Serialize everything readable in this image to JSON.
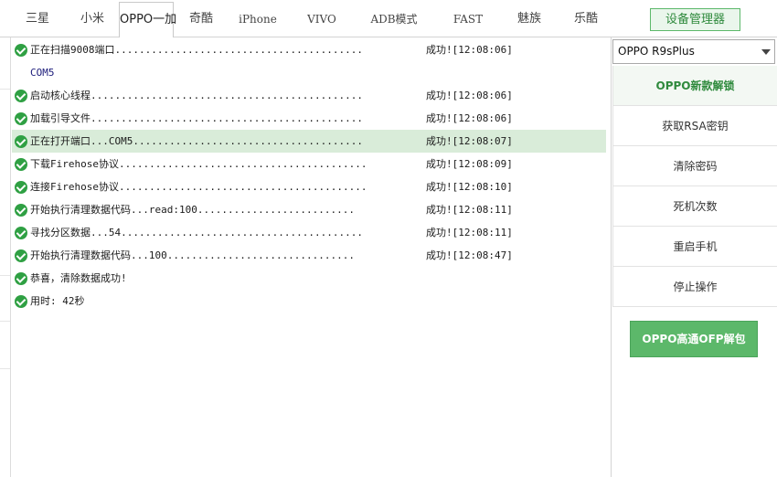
{
  "tabs": [
    {
      "label": "三星"
    },
    {
      "label": "小米"
    },
    {
      "label": "OPPO一加"
    },
    {
      "label": "奇酷"
    },
    {
      "label": "iPhone"
    },
    {
      "label": "VIVO"
    },
    {
      "label": "ADB模式"
    },
    {
      "label": "FAST"
    },
    {
      "label": "魅族"
    },
    {
      "label": "乐酷"
    }
  ],
  "active_tab": "OPPO一加",
  "device_manager_label": "设备管理器",
  "log": [
    {
      "text": "正在扫描9008端口.........................................",
      "result": "成功![12:08:06]",
      "icon": "check-circle-icon"
    },
    {
      "text": "COM5",
      "result": "",
      "icon": ""
    },
    {
      "text": "启动核心线程.............................................",
      "result": "成功![12:08:06]",
      "icon": "check-circle-icon"
    },
    {
      "text": "加载引导文件.............................................",
      "result": "成功![12:08:06]",
      "icon": "check-circle-icon"
    },
    {
      "text": "正在打开端口...COM5......................................",
      "result": "成功![12:08:07]",
      "icon": "check-circle-icon",
      "highlighted": true
    },
    {
      "text": "下载Firehose协议.........................................",
      "result": "成功![12:08:09]",
      "icon": "check-circle-icon"
    },
    {
      "text": "连接Firehose协议.........................................",
      "result": "成功![12:08:10]",
      "icon": "check-circle-icon"
    },
    {
      "text": "开始执行清理数据代码...read:100..........................",
      "result": "成功![12:08:11]",
      "icon": "check-circle-icon"
    },
    {
      "text": "寻找分区数据...54........................................",
      "result": "成功![12:08:11]",
      "icon": "check-circle-icon"
    },
    {
      "text": "开始执行清理数据代码...100...............................",
      "result": "成功![12:08:47]",
      "icon": "check-circle-icon"
    },
    {
      "text": "恭喜，清除数据成功!",
      "result": "",
      "icon": "check-circle-icon"
    },
    {
      "text": "用时: 42秒",
      "result": "",
      "icon": "check-circle-icon"
    }
  ],
  "model_select": {
    "value": "OPPO R9sPlus"
  },
  "actions": [
    {
      "label": "OPPO新款解锁",
      "primary": true
    },
    {
      "label": "获取RSA密钥"
    },
    {
      "label": "清除密码"
    },
    {
      "label": "死机次数"
    },
    {
      "label": "重启手机"
    },
    {
      "label": "停止操作"
    }
  ],
  "ofp_button_label": "OPPO高通OFP解包",
  "colors": {
    "accent_green": "#5cb86a",
    "check_green": "#2fa043",
    "highlight_row": "#d9ecd9"
  }
}
